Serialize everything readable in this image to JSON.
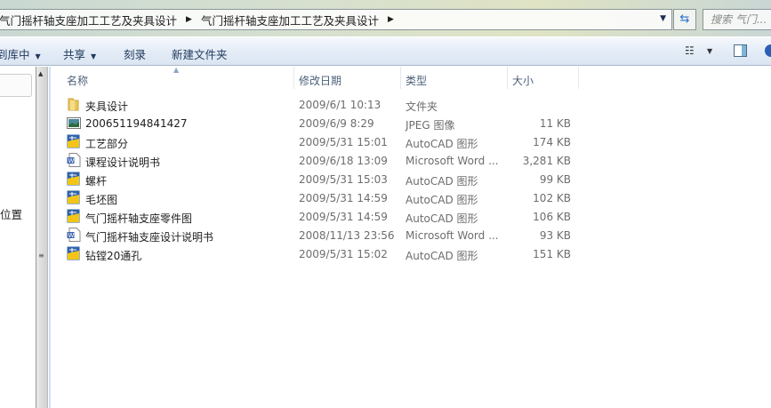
{
  "address_bar": {
    "crumbs": [
      "气门摇杆轴支座加工工艺及夹具设计",
      "气门摇杆轴支座加工工艺及夹具设计"
    ],
    "search_placeholder": "搜索 气门..."
  },
  "toolbar": {
    "include_library": "到库中",
    "share": "共享",
    "burn": "刻录",
    "new_folder": "新建文件夹"
  },
  "nav": {
    "partial_item": "位置",
    "partial_item2": ")"
  },
  "columns": {
    "name": "名称",
    "date": "修改日期",
    "type": "类型",
    "size": "大小"
  },
  "files": [
    {
      "name": "夹具设计",
      "date": "2009/6/1 10:13",
      "type": "文件夹",
      "size": "",
      "icon": "folder"
    },
    {
      "name": "200651194841427",
      "date": "2009/6/9 8:29",
      "type": "JPEG 图像",
      "size": "11 KB",
      "icon": "image"
    },
    {
      "name": "工艺部分",
      "date": "2009/5/31 15:01",
      "type": "AutoCAD 图形",
      "size": "174 KB",
      "icon": "dwg"
    },
    {
      "name": "课程设计说明书",
      "date": "2009/6/18 13:09",
      "type": "Microsoft Word ...",
      "size": "3,281 KB",
      "icon": "word"
    },
    {
      "name": "螺杆",
      "date": "2009/5/31 15:03",
      "type": "AutoCAD 图形",
      "size": "99 KB",
      "icon": "dwg"
    },
    {
      "name": "毛坯图",
      "date": "2009/5/31 14:59",
      "type": "AutoCAD 图形",
      "size": "102 KB",
      "icon": "dwg"
    },
    {
      "name": "气门摇杆轴支座零件图",
      "date": "2009/5/31 14:59",
      "type": "AutoCAD 图形",
      "size": "106 KB",
      "icon": "dwg"
    },
    {
      "name": "气门摇杆轴支座设计说明书",
      "date": "2008/11/13 23:56",
      "type": "Microsoft Word ...",
      "size": "93 KB",
      "icon": "word"
    },
    {
      "name": "钻镗20通孔",
      "date": "2009/5/31 15:02",
      "type": "AutoCAD 图形",
      "size": "151 KB",
      "icon": "dwg"
    }
  ]
}
